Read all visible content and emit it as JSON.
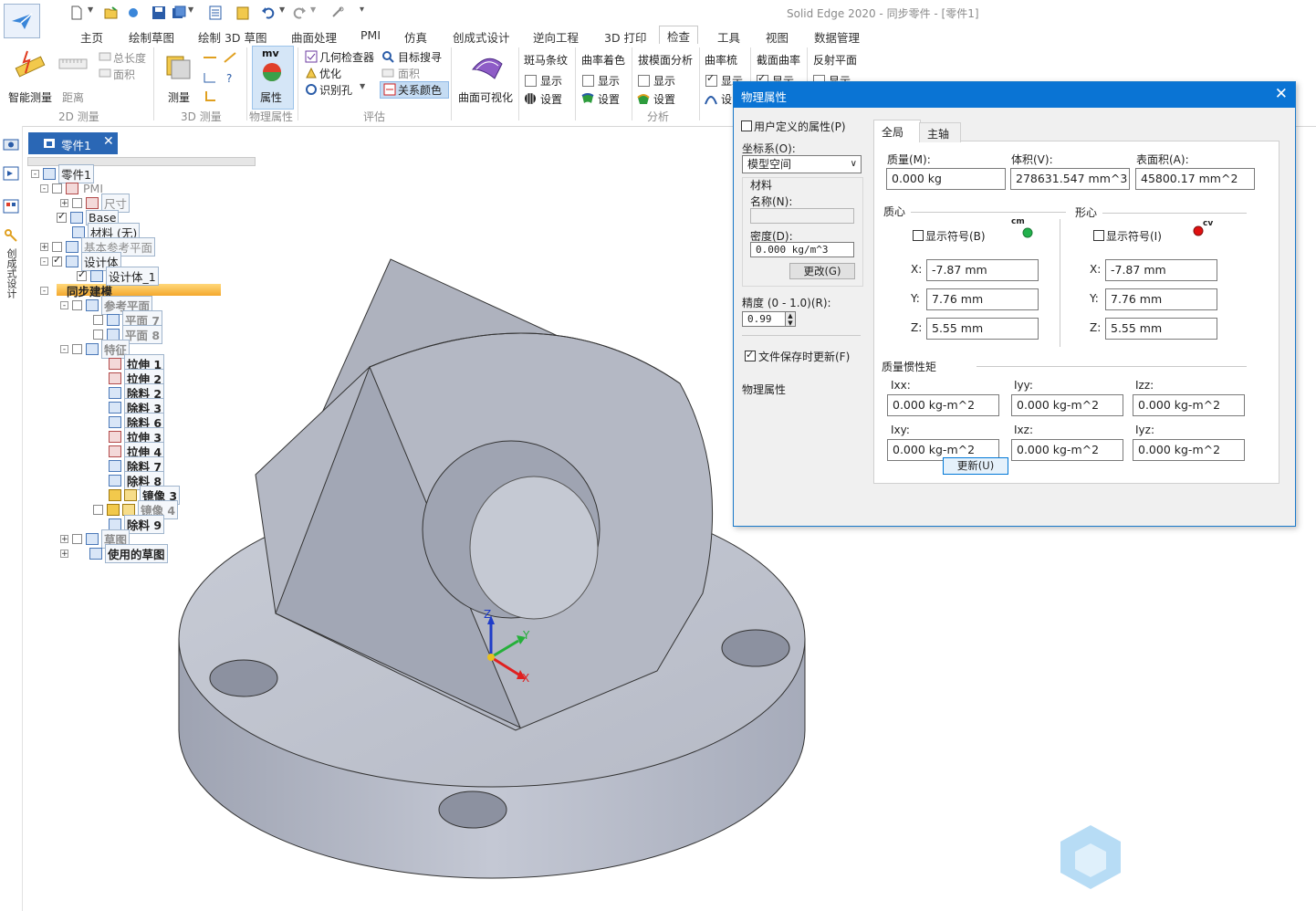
{
  "window": {
    "title": "Solid Edge 2020 - 同步零件 - [零件1]"
  },
  "menu": {
    "tabs": [
      "主页",
      "绘制草图",
      "绘制 3D 草图",
      "曲面处理",
      "PMI",
      "仿真",
      "创成式设计",
      "逆向工程",
      "3D 打印",
      "检查",
      "工具",
      "视图",
      "数据管理"
    ],
    "active": "检查"
  },
  "ribbon": {
    "measure2d": {
      "smart": "智能测量",
      "distance": "距离",
      "total_length": "总长度",
      "area": "面积",
      "group": "2D 测量"
    },
    "measure3d": {
      "measure": "测量",
      "group": "3D 测量"
    },
    "physprops": {
      "icon_text": "mv",
      "label": "属性",
      "group": "物理属性"
    },
    "evaluate": {
      "geom_checker": "几何检查器",
      "target_search": "目标搜寻",
      "optimize": "优化",
      "area": "面积",
      "identify_holes": "识别孔",
      "relation_colors": "关系颜色",
      "group": "评估"
    },
    "surface_vis": "曲面可视化",
    "zebra": {
      "title": "斑马条纹",
      "show": "显示",
      "settings": "设置"
    },
    "curv_shading": {
      "title": "曲率着色",
      "show": "显示",
      "settings": "设置"
    },
    "draft": {
      "title": "拔模面分析",
      "show": "显示",
      "settings": "设置"
    },
    "analysis_group": "分析",
    "curv_comb": {
      "title": "曲率梳",
      "show": "显示",
      "settings": "设"
    },
    "section_curv": {
      "title": "截面曲率",
      "show": "显示"
    },
    "reflect": {
      "title": "反射平面",
      "show": "显示"
    }
  },
  "left_strip": {
    "label": "创成式设计"
  },
  "doc_tab": {
    "label": "零件1",
    "close": "✕"
  },
  "tree": {
    "root": "零件1",
    "pmi": "PMI",
    "dims": "尺寸",
    "base": "Base",
    "material": "材料 (无)",
    "ref_planes": "基本参考平面",
    "design_bodies": "设计体",
    "design_body_1": "设计体_1",
    "sync_model": "同步建模",
    "ref_plane_folder": "参考平面",
    "plane7": "平面 7",
    "plane8": "平面 8",
    "features": "特征",
    "items": [
      "拉伸 1",
      "拉伸 2",
      "除料 2",
      "除料 3",
      "除料 6",
      "拉伸 3",
      "拉伸 4",
      "除料 7",
      "除料 8"
    ],
    "mirror3": "镜像 3",
    "mirror4": "镜像 4",
    "cut9": "除料 9",
    "sketches": "草图",
    "used_sketches": "使用的草图"
  },
  "triad": {
    "x": "X",
    "y": "Y",
    "z": "Z"
  },
  "dialog": {
    "title": "物理属性",
    "close": "✕",
    "user_defined": "用户定义的属性(P)",
    "coord_label": "坐标系(O):",
    "coord_value": "模型空间",
    "material_group": "材料",
    "name_label": "名称(N):",
    "name_value": "",
    "density_label": "密度(D):",
    "density_value": "0.000 kg/m^3",
    "change_button": "更改(G)",
    "accuracy_label": "精度 (0 - 1.0)(R):",
    "accuracy_value": "0.99",
    "update_on_save": "文件保存时更新(F)",
    "phys_props_label": "物理属性",
    "tabs": [
      "全局",
      "主轴"
    ],
    "mass_label": "质量(M):",
    "mass_value": "0.000 kg",
    "volume_label": "体积(V):",
    "volume_value": "278631.547 mm^3",
    "area_label": "表面积(A):",
    "area_value": "45800.17 mm^2",
    "com_title": "质心",
    "com_show": "显示符号(B)",
    "com_symbol": "cm",
    "centroid_title": "形心",
    "centroid_show": "显示符号(I)",
    "centroid_symbol": "cv",
    "x_label": "X:",
    "y_label": "Y:",
    "z_label": "Z:",
    "com": {
      "x": "-7.87 mm",
      "y": "7.76 mm",
      "z": "5.55 mm"
    },
    "centroid": {
      "x": "-7.87 mm",
      "y": "7.76 mm",
      "z": "5.55 mm"
    },
    "inertia_title": "质量惯性矩",
    "ixx_label": "Ixx:",
    "ixx": "0.000 kg-m^2",
    "iyy_label": "Iyy:",
    "iyy": "0.000 kg-m^2",
    "izz_label": "Izz:",
    "izz": "0.000 kg-m^2",
    "ixy_label": "Ixy:",
    "ixy": "0.000 kg-m^2",
    "ixz_label": "Ixz:",
    "ixz": "0.000 kg-m^2",
    "iyz_label": "Iyz:",
    "iyz": "0.000 kg-m^2",
    "update_button": "更新(U)"
  },
  "colors": {
    "accent": "#0a74d4",
    "tab": "#2a67b5",
    "model": "#b4b8c4",
    "com_dot": "#22b14c",
    "centroid_dot": "#e01010"
  }
}
